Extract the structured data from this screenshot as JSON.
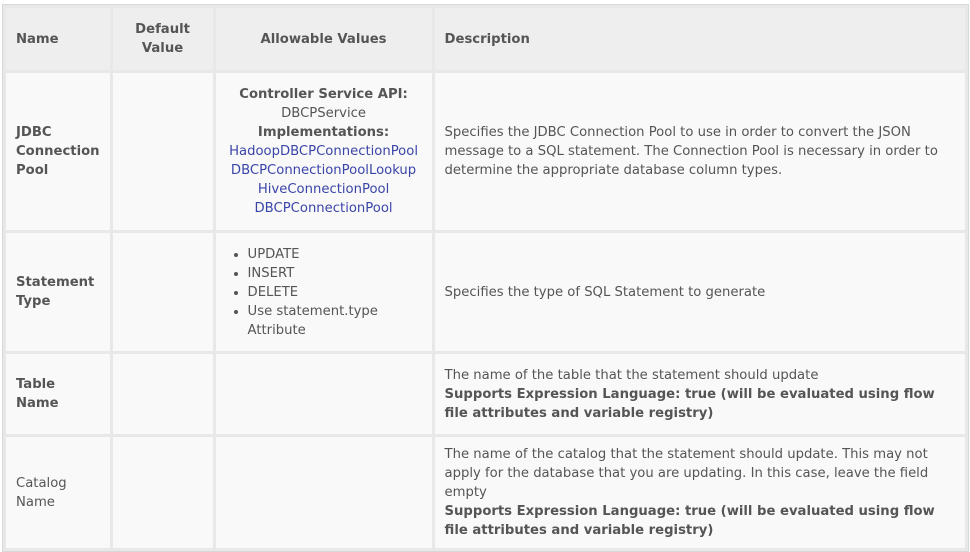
{
  "headers": {
    "name": "Name",
    "default": "Default Value",
    "allowable": "Allowable Values",
    "description": "Description"
  },
  "rows": [
    {
      "name": "JDBC Connection Pool",
      "bold": true,
      "api_label": "Controller Service API:",
      "api": "DBCPService",
      "impl_label": "Implementations:",
      "impls": [
        "HadoopDBCPConnectionPool",
        "DBCPConnectionPoolLookup",
        "HiveConnectionPool",
        "DBCPConnectionPool"
      ],
      "description": "Specifies the JDBC Connection Pool to use in order to convert the JSON message to a SQL statement. The Connection Pool is necessary in order to determine the appropriate database column types."
    },
    {
      "name": "Statement Type",
      "bold": true,
      "values": [
        "UPDATE",
        "INSERT",
        "DELETE",
        "Use statement.type Attribute"
      ],
      "description": "Specifies the type of SQL Statement to generate"
    },
    {
      "name": "Table Name",
      "bold": true,
      "description": "The name of the table that the statement should update",
      "el": "Supports Expression Language: true (will be evaluated using flow file attributes and variable registry)"
    },
    {
      "name": "Catalog Name",
      "bold": false,
      "description": "The name of the catalog that the statement should update. This may not apply for the database that you are updating. In this case, leave the field empty",
      "el": "Supports Expression Language: true (will be evaluated using flow file attributes and variable registry)"
    }
  ]
}
